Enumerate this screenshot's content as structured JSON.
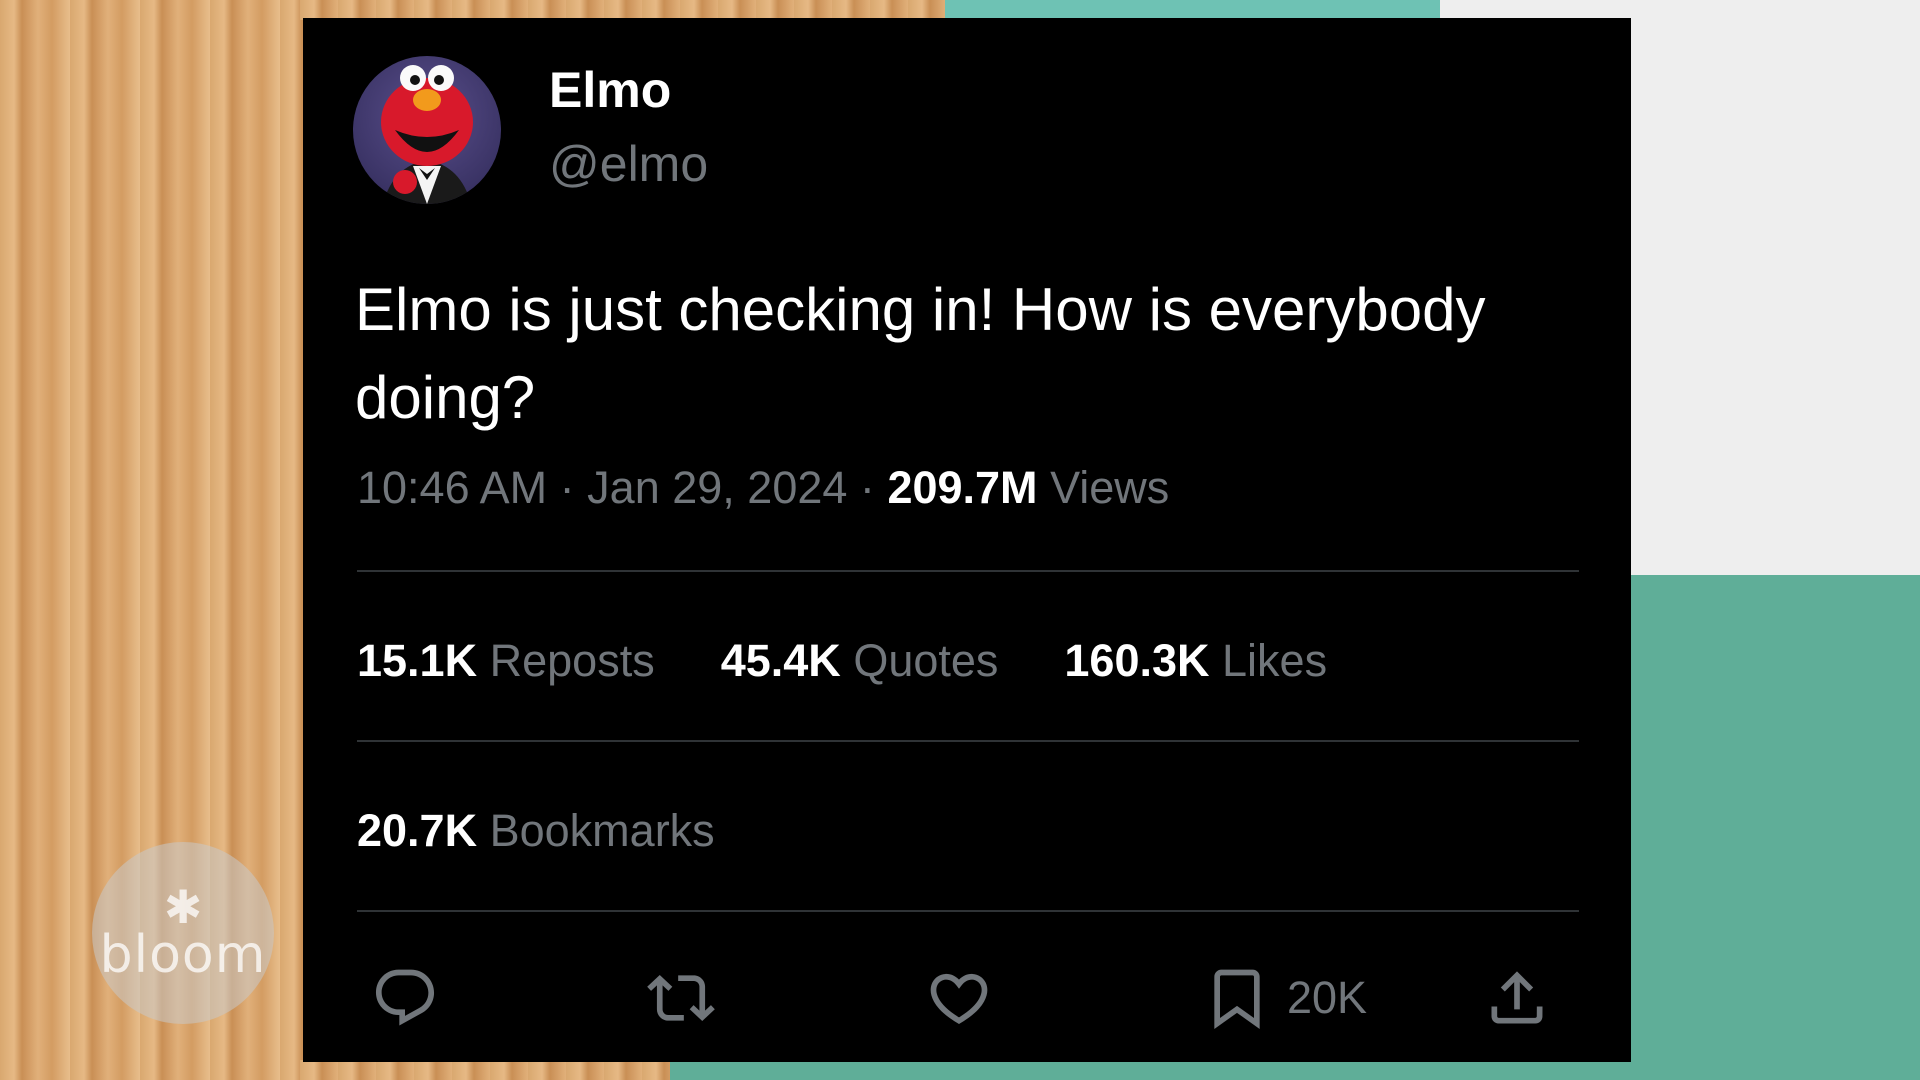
{
  "tweet": {
    "display_name": "Elmo",
    "handle": "@elmo",
    "text": "Elmo is just checking in! How is everybody doing?",
    "time": "10:46 AM",
    "separator": "·",
    "date": "Jan 29, 2024",
    "views_count": "209.7M",
    "views_label": "Views"
  },
  "stats": {
    "reposts_count": "15.1K",
    "reposts_label": "Reposts",
    "quotes_count": "45.4K",
    "quotes_label": "Quotes",
    "likes_count": "160.3K",
    "likes_label": "Likes",
    "bookmarks_count": "20.7K",
    "bookmarks_label": "Bookmarks"
  },
  "actions": {
    "reply_icon": "reply-icon",
    "repost_icon": "repost-icon",
    "like_icon": "heart-icon",
    "bookmark_icon": "bookmark-icon",
    "bookmark_count": "20K",
    "share_icon": "share-icon"
  },
  "watermark": {
    "text": "bloom"
  },
  "colors": {
    "card_background": "#000000",
    "primary_text": "#ffffff",
    "secondary_text": "#71767b",
    "divider": "#2f3336"
  }
}
